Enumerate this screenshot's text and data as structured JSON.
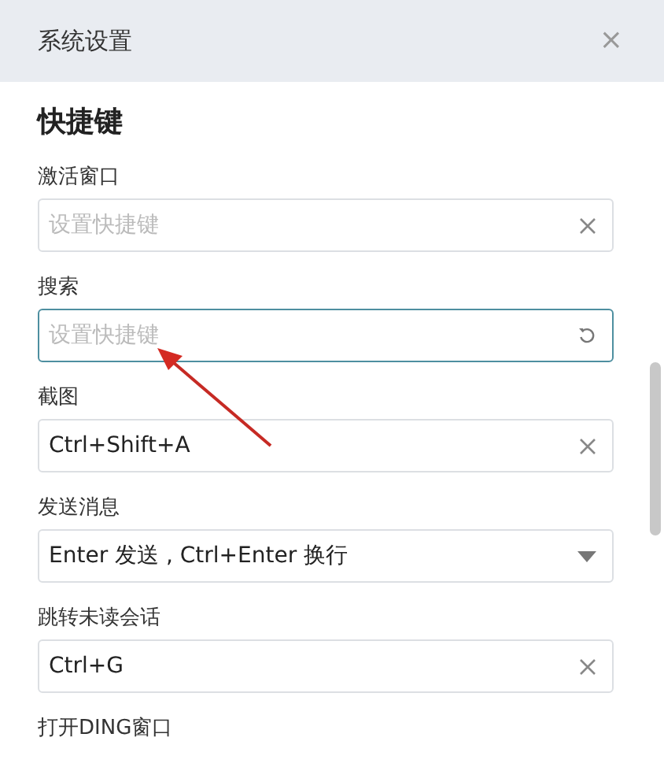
{
  "window": {
    "title": "系统设置",
    "close": "×"
  },
  "section": {
    "title": "快捷键"
  },
  "fields": [
    {
      "label": "激活窗口",
      "placeholder": "设置快捷键",
      "kind": "clear",
      "focused": false
    },
    {
      "label": "搜索",
      "placeholder": "设置快捷键",
      "kind": "reset",
      "focused": true
    },
    {
      "label": "截图",
      "value": "Ctrl+Shift+A",
      "kind": "clear",
      "focused": false
    },
    {
      "label": "发送消息",
      "value": "Enter 发送 , Ctrl+Enter 换行",
      "kind": "select",
      "focused": false
    },
    {
      "label": "跳转未读会话",
      "value": "Ctrl+G",
      "kind": "clear",
      "focused": false
    },
    {
      "label": "打开DING窗口"
    }
  ]
}
